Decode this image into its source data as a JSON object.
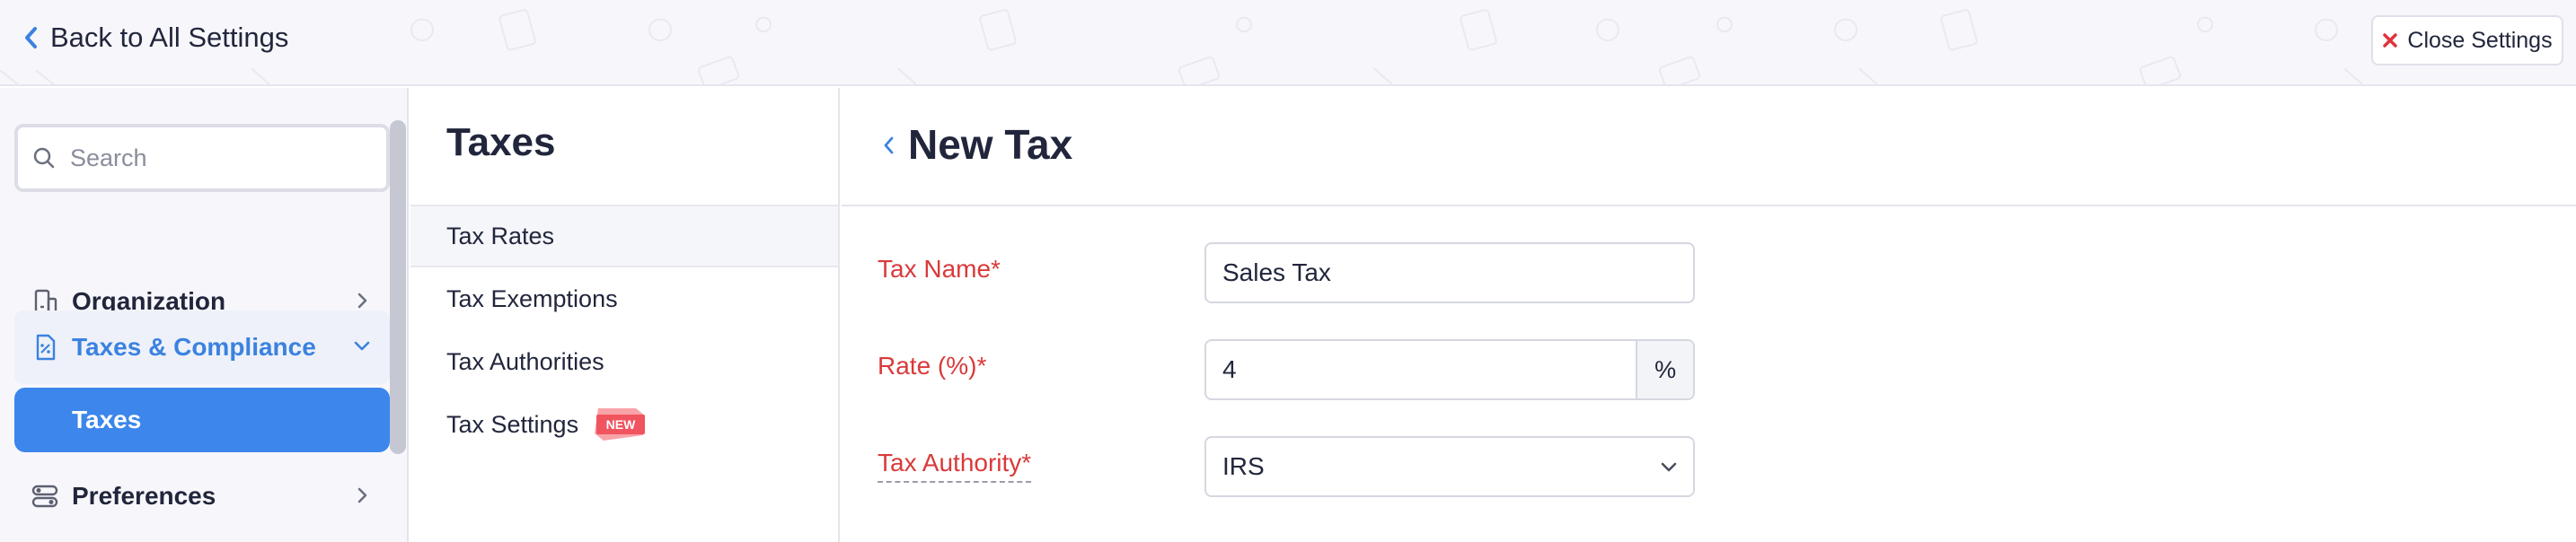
{
  "topbar": {
    "back_label": "Back to All Settings",
    "close_label": "Close Settings"
  },
  "sidebar": {
    "search_placeholder": "Search",
    "items": [
      {
        "label": "Organization",
        "icon": "building-icon",
        "state": "collapsed"
      },
      {
        "label": "Taxes & Compliance",
        "icon": "tax-doc-icon",
        "state": "expanded"
      },
      {
        "label": "Preferences",
        "icon": "toggles-icon",
        "state": "collapsed"
      }
    ],
    "subitems": [
      {
        "label": "Taxes",
        "selected": true
      }
    ]
  },
  "middle": {
    "title": "Taxes",
    "items": [
      {
        "label": "Tax Rates",
        "active": true
      },
      {
        "label": "Tax Exemptions"
      },
      {
        "label": "Tax Authorities"
      },
      {
        "label": "Tax Settings",
        "badge": "NEW"
      }
    ]
  },
  "form": {
    "title": "New Tax",
    "name_label": "Tax Name*",
    "name_value": "Sales Tax",
    "rate_label": "Rate (%)*",
    "rate_value": "4",
    "rate_suffix": "%",
    "authority_label": "Tax Authority*",
    "authority_value": "IRS"
  },
  "colors": {
    "accent": "#3c86ec",
    "required_label": "#d93a3a",
    "badge": "#f0545f",
    "text": "#21263c"
  }
}
